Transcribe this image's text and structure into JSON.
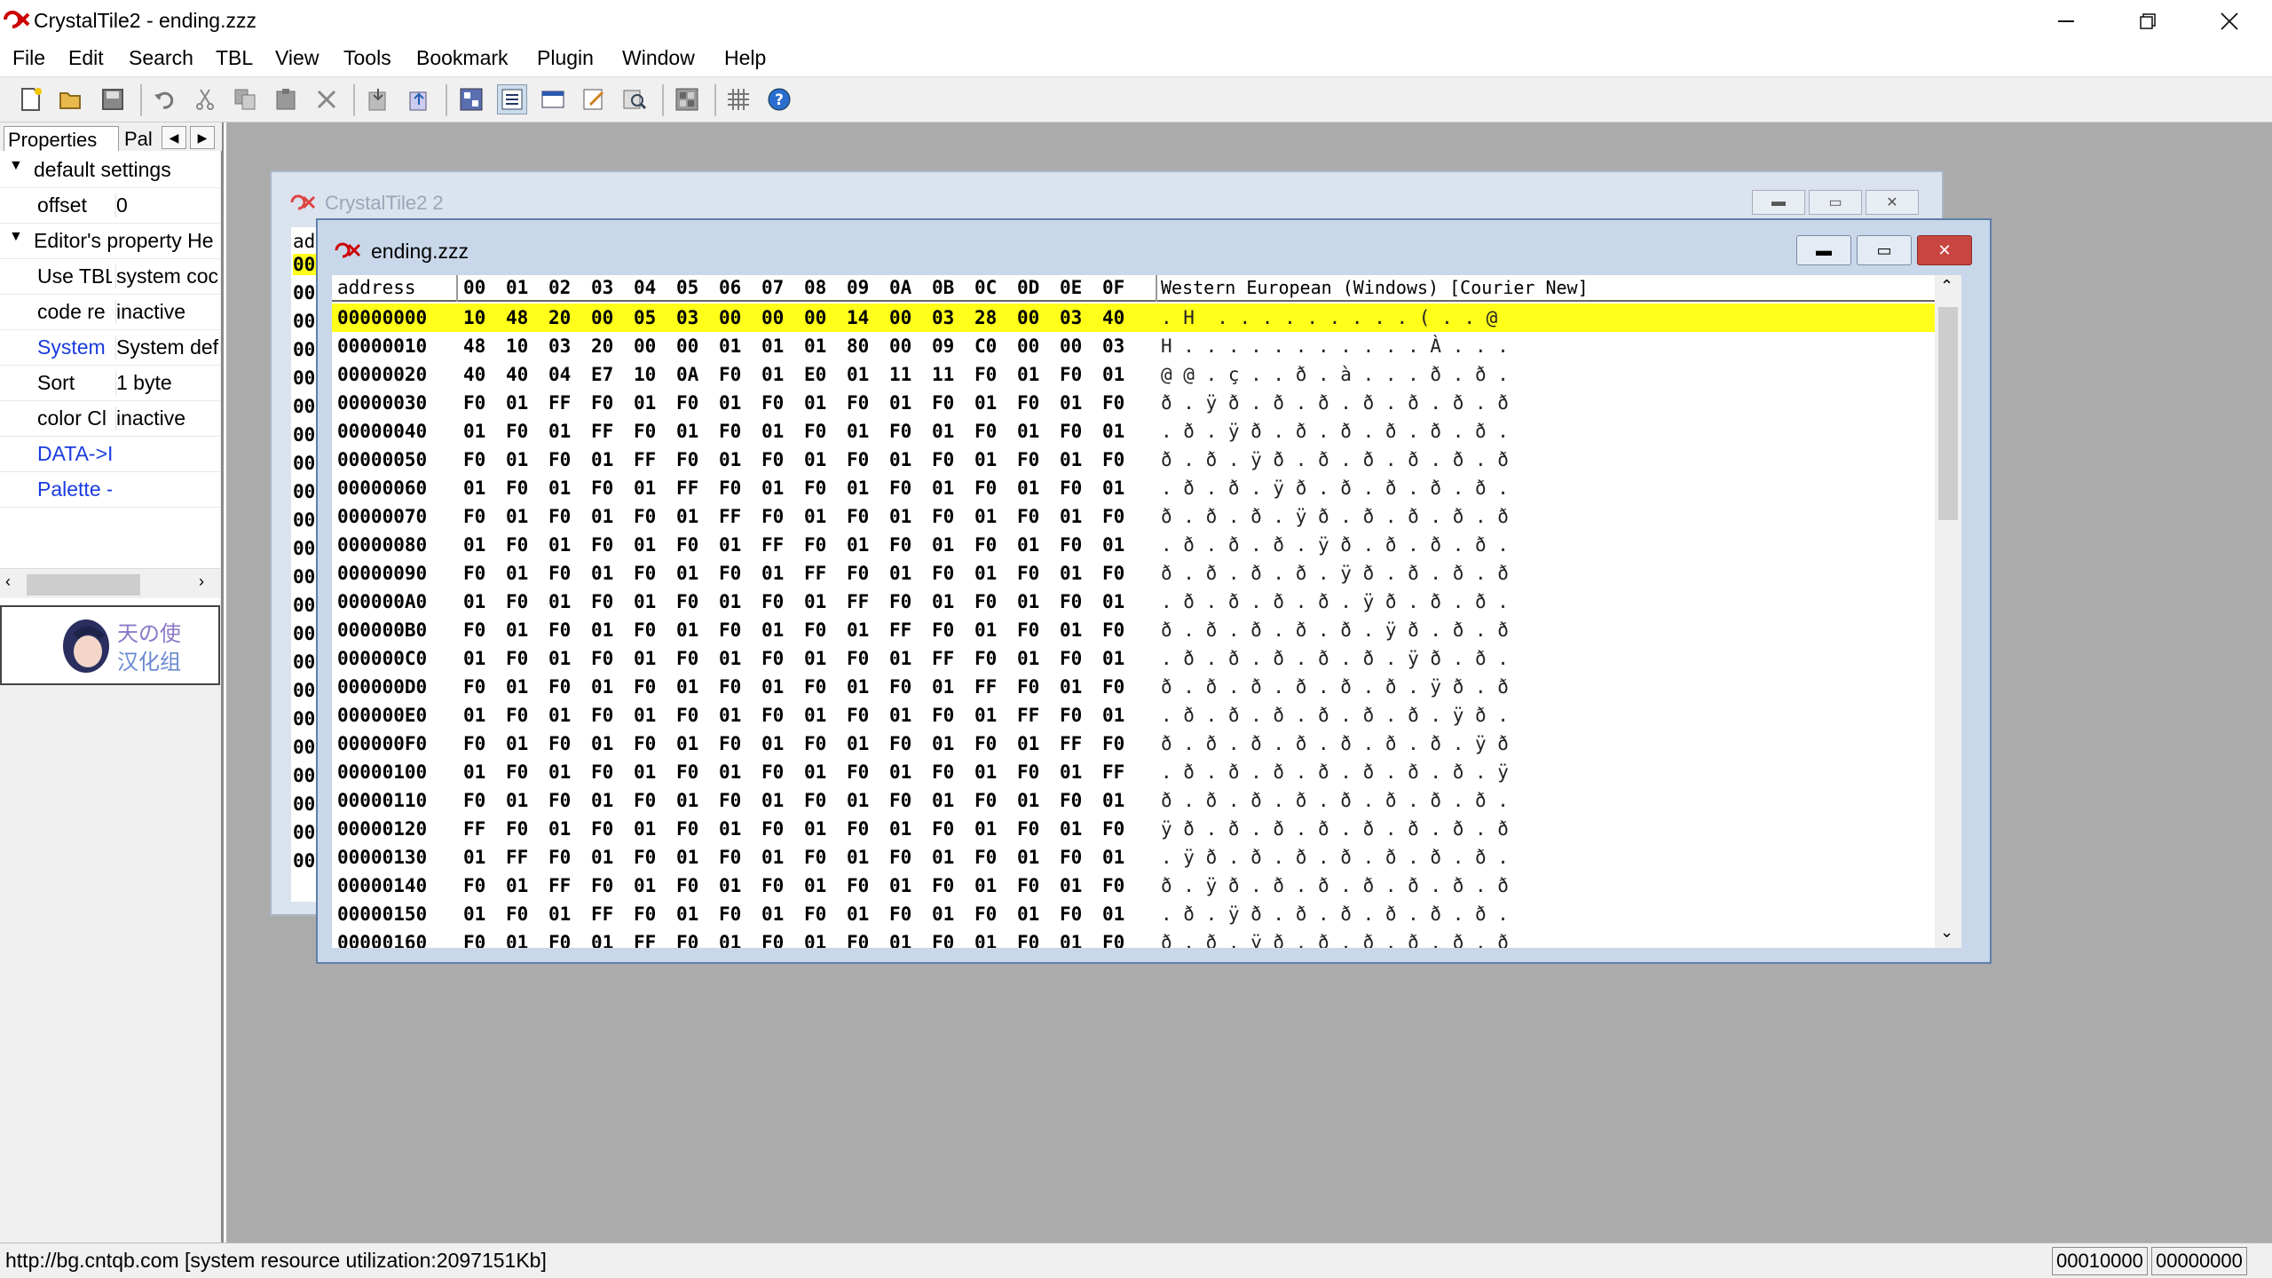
{
  "window": {
    "title": "CrystalTile2 - ending.zzz"
  },
  "menu": [
    "File",
    "Edit",
    "Search",
    "TBL",
    "View",
    "Tools",
    "Bookmark",
    "Plugin",
    "Window",
    "Help"
  ],
  "left_panel": {
    "tabs": [
      "Properties",
      "Pal"
    ],
    "categories": [
      "default settings",
      "Editor's property He"
    ],
    "rows": [
      {
        "name": "offset",
        "value": "0",
        "blue": false
      },
      {
        "name": "Use TBL",
        "value": "system coc",
        "blue": false
      },
      {
        "name": "code re",
        "value": "inactive",
        "blue": false
      },
      {
        "name": "System I",
        "value": "System def",
        "blue": true
      },
      {
        "name": "Sort",
        "value": "1 byte",
        "blue": false
      },
      {
        "name": "color Cl",
        "value": "inactive",
        "blue": false
      },
      {
        "name": "DATA->I",
        "value": "",
        "blue": true
      },
      {
        "name": "Palette -",
        "value": "",
        "blue": true
      }
    ],
    "logo_text": "天の使 汉化组"
  },
  "back_window": {
    "title": "CrystalTile2 2",
    "col_header": "ad",
    "row_prefix": "00"
  },
  "front_window": {
    "title": "ending.zzz"
  },
  "hex": {
    "address_header": "address",
    "col_headers": [
      "00",
      "01",
      "02",
      "03",
      "04",
      "05",
      "06",
      "07",
      "08",
      "09",
      "0A",
      "0B",
      "0C",
      "0D",
      "0E",
      "0F"
    ],
    "encoding_header": "Western European (Windows) [Courier New]",
    "rows": [
      {
        "addr": "00000000",
        "bytes": [
          "10",
          "48",
          "20",
          "00",
          "05",
          "03",
          "00",
          "00",
          "00",
          "14",
          "00",
          "03",
          "28",
          "00",
          "03",
          "40"
        ],
        "text": ". H  . . . . . . . . . ( . . @"
      },
      {
        "addr": "00000010",
        "bytes": [
          "48",
          "10",
          "03",
          "20",
          "00",
          "00",
          "01",
          "01",
          "01",
          "80",
          "00",
          "09",
          "C0",
          "00",
          "00",
          "03"
        ],
        "text": "H . . . . . . . . . . . À . . ."
      },
      {
        "addr": "00000020",
        "bytes": [
          "40",
          "40",
          "04",
          "E7",
          "10",
          "0A",
          "F0",
          "01",
          "E0",
          "01",
          "11",
          "11",
          "F0",
          "01",
          "F0",
          "01"
        ],
        "text": "@ @ . ç . . ð . à . . . ð . ð ."
      },
      {
        "addr": "00000030",
        "bytes": [
          "F0",
          "01",
          "FF",
          "F0",
          "01",
          "F0",
          "01",
          "F0",
          "01",
          "F0",
          "01",
          "F0",
          "01",
          "F0",
          "01",
          "F0"
        ],
        "text": "ð . ÿ ð . ð . ð . ð . ð . ð . ð"
      },
      {
        "addr": "00000040",
        "bytes": [
          "01",
          "F0",
          "01",
          "FF",
          "F0",
          "01",
          "F0",
          "01",
          "F0",
          "01",
          "F0",
          "01",
          "F0",
          "01",
          "F0",
          "01"
        ],
        "text": ". ð . ÿ ð . ð . ð . ð . ð . ð ."
      },
      {
        "addr": "00000050",
        "bytes": [
          "F0",
          "01",
          "F0",
          "01",
          "FF",
          "F0",
          "01",
          "F0",
          "01",
          "F0",
          "01",
          "F0",
          "01",
          "F0",
          "01",
          "F0"
        ],
        "text": "ð . ð . ÿ ð . ð . ð . ð . ð . ð"
      },
      {
        "addr": "00000060",
        "bytes": [
          "01",
          "F0",
          "01",
          "F0",
          "01",
          "FF",
          "F0",
          "01",
          "F0",
          "01",
          "F0",
          "01",
          "F0",
          "01",
          "F0",
          "01"
        ],
        "text": ". ð . ð . ÿ ð . ð . ð . ð . ð ."
      },
      {
        "addr": "00000070",
        "bytes": [
          "F0",
          "01",
          "F0",
          "01",
          "F0",
          "01",
          "FF",
          "F0",
          "01",
          "F0",
          "01",
          "F0",
          "01",
          "F0",
          "01",
          "F0"
        ],
        "text": "ð . ð . ð . ÿ ð . ð . ð . ð . ð"
      },
      {
        "addr": "00000080",
        "bytes": [
          "01",
          "F0",
          "01",
          "F0",
          "01",
          "F0",
          "01",
          "FF",
          "F0",
          "01",
          "F0",
          "01",
          "F0",
          "01",
          "F0",
          "01"
        ],
        "text": ". ð . ð . ð . ÿ ð . ð . ð . ð ."
      },
      {
        "addr": "00000090",
        "bytes": [
          "F0",
          "01",
          "F0",
          "01",
          "F0",
          "01",
          "F0",
          "01",
          "FF",
          "F0",
          "01",
          "F0",
          "01",
          "F0",
          "01",
          "F0"
        ],
        "text": "ð . ð . ð . ð . ÿ ð . ð . ð . ð"
      },
      {
        "addr": "000000A0",
        "bytes": [
          "01",
          "F0",
          "01",
          "F0",
          "01",
          "F0",
          "01",
          "F0",
          "01",
          "FF",
          "F0",
          "01",
          "F0",
          "01",
          "F0",
          "01"
        ],
        "text": ". ð . ð . ð . ð . ÿ ð . ð . ð ."
      },
      {
        "addr": "000000B0",
        "bytes": [
          "F0",
          "01",
          "F0",
          "01",
          "F0",
          "01",
          "F0",
          "01",
          "F0",
          "01",
          "FF",
          "F0",
          "01",
          "F0",
          "01",
          "F0"
        ],
        "text": "ð . ð . ð . ð . ð . ÿ ð . ð . ð"
      },
      {
        "addr": "000000C0",
        "bytes": [
          "01",
          "F0",
          "01",
          "F0",
          "01",
          "F0",
          "01",
          "F0",
          "01",
          "F0",
          "01",
          "FF",
          "F0",
          "01",
          "F0",
          "01"
        ],
        "text": ". ð . ð . ð . ð . ð . ÿ ð . ð ."
      },
      {
        "addr": "000000D0",
        "bytes": [
          "F0",
          "01",
          "F0",
          "01",
          "F0",
          "01",
          "F0",
          "01",
          "F0",
          "01",
          "F0",
          "01",
          "FF",
          "F0",
          "01",
          "F0"
        ],
        "text": "ð . ð . ð . ð . ð . ð . ÿ ð . ð"
      },
      {
        "addr": "000000E0",
        "bytes": [
          "01",
          "F0",
          "01",
          "F0",
          "01",
          "F0",
          "01",
          "F0",
          "01",
          "F0",
          "01",
          "F0",
          "01",
          "FF",
          "F0",
          "01"
        ],
        "text": ". ð . ð . ð . ð . ð . ð . ÿ ð ."
      },
      {
        "addr": "000000F0",
        "bytes": [
          "F0",
          "01",
          "F0",
          "01",
          "F0",
          "01",
          "F0",
          "01",
          "F0",
          "01",
          "F0",
          "01",
          "F0",
          "01",
          "FF",
          "F0"
        ],
        "text": "ð . ð . ð . ð . ð . ð . ð . ÿ ð"
      },
      {
        "addr": "00000100",
        "bytes": [
          "01",
          "F0",
          "01",
          "F0",
          "01",
          "F0",
          "01",
          "F0",
          "01",
          "F0",
          "01",
          "F0",
          "01",
          "F0",
          "01",
          "FF"
        ],
        "text": ". ð . ð . ð . ð . ð . ð . ð . ÿ"
      },
      {
        "addr": "00000110",
        "bytes": [
          "F0",
          "01",
          "F0",
          "01",
          "F0",
          "01",
          "F0",
          "01",
          "F0",
          "01",
          "F0",
          "01",
          "F0",
          "01",
          "F0",
          "01"
        ],
        "text": "ð . ð . ð . ð . ð . ð . ð . ð ."
      },
      {
        "addr": "00000120",
        "bytes": [
          "FF",
          "F0",
          "01",
          "F0",
          "01",
          "F0",
          "01",
          "F0",
          "01",
          "F0",
          "01",
          "F0",
          "01",
          "F0",
          "01",
          "F0"
        ],
        "text": "ÿ ð . ð . ð . ð . ð . ð . ð . ð"
      },
      {
        "addr": "00000130",
        "bytes": [
          "01",
          "FF",
          "F0",
          "01",
          "F0",
          "01",
          "F0",
          "01",
          "F0",
          "01",
          "F0",
          "01",
          "F0",
          "01",
          "F0",
          "01"
        ],
        "text": ". ÿ ð . ð . ð . ð . ð . ð . ð ."
      },
      {
        "addr": "00000140",
        "bytes": [
          "F0",
          "01",
          "FF",
          "F0",
          "01",
          "F0",
          "01",
          "F0",
          "01",
          "F0",
          "01",
          "F0",
          "01",
          "F0",
          "01",
          "F0"
        ],
        "text": "ð . ÿ ð . ð . ð . ð . ð . ð . ð"
      },
      {
        "addr": "00000150",
        "bytes": [
          "01",
          "F0",
          "01",
          "FF",
          "F0",
          "01",
          "F0",
          "01",
          "F0",
          "01",
          "F0",
          "01",
          "F0",
          "01",
          "F0",
          "01"
        ],
        "text": ". ð . ÿ ð . ð . ð . ð . ð . ð ."
      },
      {
        "addr": "00000160",
        "bytes": [
          "F0",
          "01",
          "F0",
          "01",
          "FF",
          "F0",
          "01",
          "F0",
          "01",
          "F0",
          "01",
          "F0",
          "01",
          "F0",
          "01",
          "F0"
        ],
        "text": "ð . ð . ÿ ð . ð . ð . ð . ð . ð"
      }
    ]
  },
  "status": {
    "url": "http://bg.cntqb.com [system resource utilization:2097151Kb]",
    "box1": "00010000",
    "box2": "00000000"
  },
  "colors": {
    "selection": "#ffff1a",
    "highlight": "#7b7cf0",
    "mdi": "#ababab"
  },
  "icons": [
    "new-icon",
    "open-icon",
    "save-icon",
    "undo-icon",
    "cut-icon",
    "copy-icon",
    "paste-icon",
    "delete-icon",
    "import-icon",
    "export-icon",
    "tile-view-icon",
    "hex-view-icon",
    "text-view-icon",
    "edit-icon",
    "search-icon",
    "palette-icon",
    "grid-icon",
    "help-icon"
  ]
}
